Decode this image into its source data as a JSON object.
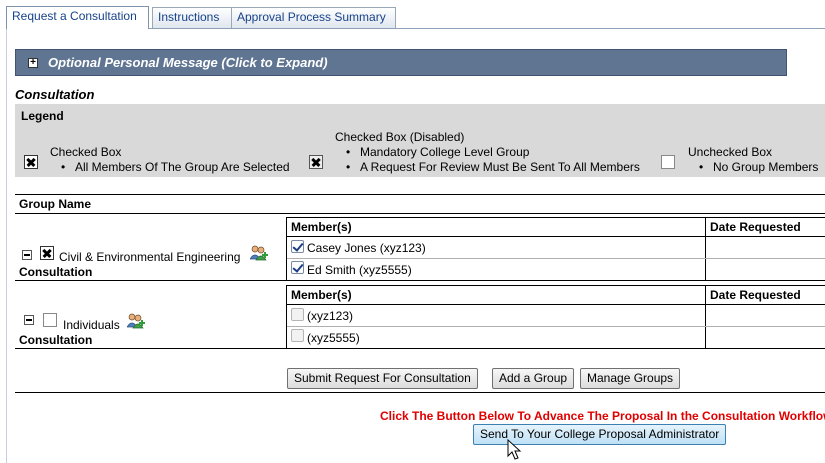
{
  "tabs": [
    {
      "label": "Request a Consultation",
      "active": true
    },
    {
      "label": "Instructions",
      "active": false
    },
    {
      "label": "Approval Process Summary",
      "active": false
    }
  ],
  "message_bar": {
    "label": "Optional Personal Message (Click to Expand)"
  },
  "section_title": "Consultation",
  "legend": {
    "title": "Legend",
    "items": [
      {
        "label": "Checked Box",
        "bullets": [
          "All Members Of The Group Are Selected"
        ]
      },
      {
        "label": "Checked Box (Disabled)",
        "bullets": [
          "Mandatory College Level Group",
          "A Request For Review Must Be Sent To All Members"
        ]
      },
      {
        "label": "Unchecked Box",
        "bullets": [
          "No Group Members"
        ]
      }
    ]
  },
  "group_table": {
    "header": "Group Name",
    "groups": [
      {
        "name": "Civil & Environmental Engineering",
        "type": "Consultation",
        "member_header": "Member(s)",
        "date_header": "Date Requested",
        "members": [
          {
            "name": "Casey Jones (xyz123)",
            "checked": true,
            "date": ""
          },
          {
            "name": "Ed Smith (xyz5555)",
            "checked": true,
            "date": ""
          }
        ]
      },
      {
        "name": "Individuals",
        "type": "Consultation",
        "member_header": "Member(s)",
        "date_header": "Date Requested",
        "members": [
          {
            "name": "(xyz123)",
            "checked": false,
            "date": ""
          },
          {
            "name": "(xyz5555)",
            "checked": false,
            "date": ""
          }
        ]
      }
    ]
  },
  "buttons": {
    "submit": "Submit Request For Consultation",
    "add_group": "Add a Group",
    "manage_groups": "Manage Groups",
    "send": "Send To Your College Proposal Administrator"
  },
  "advance_note": "Click The Button Below To Advance The Proposal In the Consultation Workflow",
  "colors": {
    "tab_text": "#17428a",
    "header_bar": "#5f7592",
    "legend_bg": "#d9d9d9",
    "note_red": "#e00000"
  }
}
